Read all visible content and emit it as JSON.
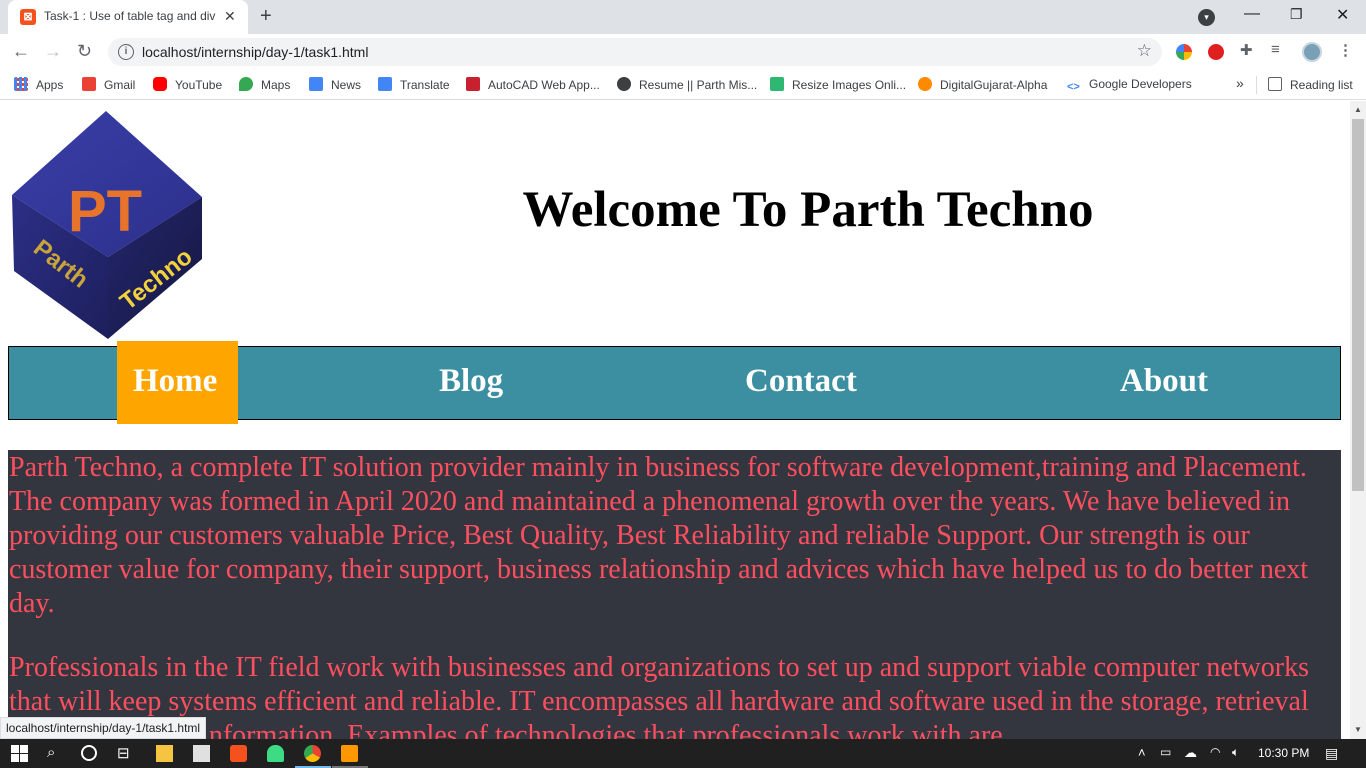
{
  "browser": {
    "tab_title": "Task-1 : Use of table tag and div t",
    "tab_favicon": "⊠",
    "url": "localhost/internship/day-1/task1.html",
    "status_url": "localhost/internship/day-1/task1.html"
  },
  "bookmarks": [
    {
      "label": "Apps",
      "icon": "apps-grid-icon",
      "color": "#4285f4"
    },
    {
      "label": "Gmail",
      "icon": "gmail-icon",
      "color": "#ea4335"
    },
    {
      "label": "YouTube",
      "icon": "youtube-icon",
      "color": "#ff0000"
    },
    {
      "label": "Maps",
      "icon": "maps-pin-icon",
      "color": "#34a853"
    },
    {
      "label": "News",
      "icon": "news-icon",
      "color": "#4285f4"
    },
    {
      "label": "Translate",
      "icon": "translate-icon",
      "color": "#4285f4"
    },
    {
      "label": "AutoCAD Web App...",
      "icon": "autocad-icon",
      "color": "#c8202f"
    },
    {
      "label": "Resume || Parth Mis...",
      "icon": "globe-icon",
      "color": "#3c4043"
    },
    {
      "label": "Resize Images Onli...",
      "icon": "resize-icon",
      "color": "#2eb872"
    },
    {
      "label": "DigitalGujarat-Alpha",
      "icon": "digitalgujarat-icon",
      "color": "#ff8a00"
    },
    {
      "label": "Google Developers",
      "icon": "code-brackets-icon",
      "color": "#4285f4"
    }
  ],
  "bookmarks_overflow": "»",
  "reading_list": "Reading list",
  "page": {
    "logo_text_top": "PT",
    "logo_text_left": "Parth",
    "logo_text_right": "Techno",
    "heading": "Welcome To Parth Techno",
    "nav": [
      "Home",
      "Blog",
      "Contact",
      "About"
    ],
    "paragraphs": [
      "Parth Techno, a complete IT solution provider mainly in business for software development,training and Placement. The company was formed in April 2020 and maintained a phenomenal growth over the years. We have believed in providing our customers valuable Price, Best Quality, Best Reliability and reliable Support. Our strength is our customer value for company, their support, business relationship and advices which have helped us to do better next day.",
      "Professionals in the IT field work with businesses and organizations to set up and support viable computer networks that will keep systems efficient and reliable. IT encompasses all hardware and software used in the storage, retrieval and accessing of information. Examples of technologies that professionals work with are"
    ]
  },
  "colors": {
    "nav_bg": "#3c8fa1",
    "nav_active": "#ffa500",
    "content_bg": "#33363f",
    "content_text": "#ff4f5f"
  },
  "taskbar": {
    "clock": "10:30 PM"
  }
}
